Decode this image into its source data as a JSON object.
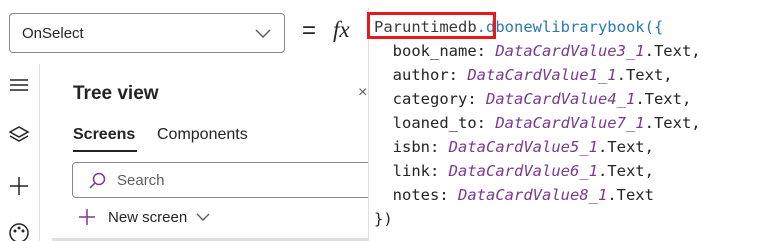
{
  "formula_bar": {
    "property": "OnSelect",
    "equals": "=",
    "fx": "fx"
  },
  "tree_view": {
    "title": "Tree view",
    "close": "×",
    "tabs": [
      "Screens",
      "Components"
    ],
    "search_placeholder": "Search",
    "new_screen": "New screen"
  },
  "code": {
    "datasource": "Paruntimedb",
    "function": ".dbonewlibrarybook({",
    "fields": [
      {
        "name": "book_name: ",
        "value": "DataCardValue3_1",
        "suffix": ".Text,"
      },
      {
        "name": "author: ",
        "value": "DataCardValue1_1",
        "suffix": ".Text,"
      },
      {
        "name": "category: ",
        "value": "DataCardValue4_1",
        "suffix": ".Text,"
      },
      {
        "name": "loaned_to: ",
        "value": "DataCardValue7_1",
        "suffix": ".Text,"
      },
      {
        "name": "isbn: ",
        "value": "DataCardValue5_1",
        "suffix": ".Text,"
      },
      {
        "name": "link: ",
        "value": "DataCardValue6_1",
        "suffix": ".Text,"
      },
      {
        "name": "notes: ",
        "value": "DataCardValue8_1",
        "suffix": ".Text"
      }
    ],
    "closing": "})"
  },
  "colors": {
    "highlight": "#e8191c",
    "param": "#7a3a8f",
    "function": "#2a78b5"
  }
}
